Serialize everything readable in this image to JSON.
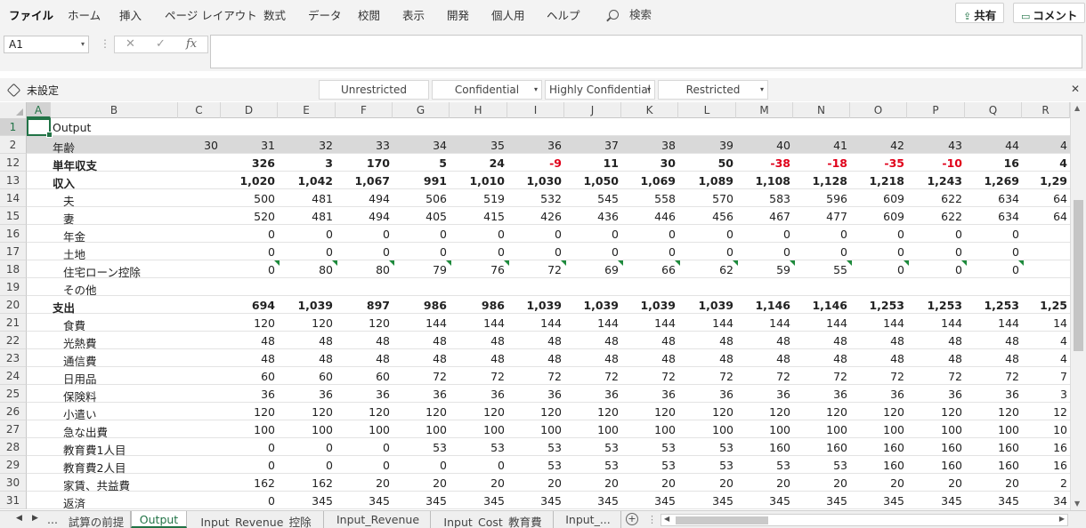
{
  "ribbon": {
    "tabs": [
      "ファイル",
      "ホーム",
      "挿入",
      "ページ レイアウト",
      "数式",
      "データ",
      "校閲",
      "表示",
      "開発",
      "個人用",
      "ヘルプ"
    ],
    "search_label": "検索",
    "share_label": "共有",
    "comment_label": "コメント"
  },
  "formula_bar": {
    "name_box": "A1",
    "formula": ""
  },
  "sensitivity": {
    "label": "未設定",
    "options": [
      "Unrestricted",
      "Confidential",
      "Highly Confidential",
      "Restricted"
    ]
  },
  "grid": {
    "columns": [
      "A",
      "B",
      "C",
      "D",
      "E",
      "F",
      "G",
      "H",
      "I",
      "J",
      "K",
      "L",
      "M",
      "N",
      "O",
      "P",
      "Q",
      "R"
    ],
    "rows": [
      {
        "n": "1",
        "label": "Output",
        "cells": []
      },
      {
        "n": "2",
        "label": "年齢",
        "cells": [
          "30",
          "31",
          "32",
          "33",
          "34",
          "35",
          "36",
          "37",
          "38",
          "39",
          "40",
          "41",
          "42",
          "43",
          "44",
          "4"
        ]
      },
      {
        "n": "12",
        "label": "単年収支",
        "cells": [
          "",
          "326",
          "3",
          "170",
          "5",
          "24",
          "-9",
          "11",
          "30",
          "50",
          "-38",
          "-18",
          "-35",
          "-10",
          "16",
          "4"
        ]
      },
      {
        "n": "13",
        "label": "収入",
        "cells": [
          "",
          "1,020",
          "1,042",
          "1,067",
          "991",
          "1,010",
          "1,030",
          "1,050",
          "1,069",
          "1,089",
          "1,108",
          "1,128",
          "1,218",
          "1,243",
          "1,269",
          "1,29"
        ]
      },
      {
        "n": "14",
        "label": "夫",
        "cells": [
          "",
          "500",
          "481",
          "494",
          "506",
          "519",
          "532",
          "545",
          "558",
          "570",
          "583",
          "596",
          "609",
          "622",
          "634",
          "64"
        ]
      },
      {
        "n": "15",
        "label": "妻",
        "cells": [
          "",
          "520",
          "481",
          "494",
          "405",
          "415",
          "426",
          "436",
          "446",
          "456",
          "467",
          "477",
          "609",
          "622",
          "634",
          "64"
        ]
      },
      {
        "n": "16",
        "label": "年金",
        "cells": [
          "",
          "0",
          "0",
          "0",
          "0",
          "0",
          "0",
          "0",
          "0",
          "0",
          "0",
          "0",
          "0",
          "0",
          "0",
          ""
        ]
      },
      {
        "n": "17",
        "label": "土地",
        "cells": [
          "",
          "0",
          "0",
          "0",
          "0",
          "0",
          "0",
          "0",
          "0",
          "0",
          "0",
          "0",
          "0",
          "0",
          "0",
          ""
        ]
      },
      {
        "n": "18",
        "label": "住宅ローン控除",
        "cells": [
          "",
          "0",
          "80",
          "80",
          "79",
          "76",
          "72",
          "69",
          "66",
          "62",
          "59",
          "55",
          "0",
          "0",
          "0",
          ""
        ]
      },
      {
        "n": "19",
        "label": "その他",
        "cells": []
      },
      {
        "n": "20",
        "label": "支出",
        "cells": [
          "",
          "694",
          "1,039",
          "897",
          "986",
          "986",
          "1,039",
          "1,039",
          "1,039",
          "1,039",
          "1,146",
          "1,146",
          "1,253",
          "1,253",
          "1,253",
          "1,25"
        ]
      },
      {
        "n": "21",
        "label": "食費",
        "cells": [
          "",
          "120",
          "120",
          "120",
          "144",
          "144",
          "144",
          "144",
          "144",
          "144",
          "144",
          "144",
          "144",
          "144",
          "144",
          "14"
        ]
      },
      {
        "n": "22",
        "label": "光熱費",
        "cells": [
          "",
          "48",
          "48",
          "48",
          "48",
          "48",
          "48",
          "48",
          "48",
          "48",
          "48",
          "48",
          "48",
          "48",
          "48",
          "4"
        ]
      },
      {
        "n": "23",
        "label": "通信費",
        "cells": [
          "",
          "48",
          "48",
          "48",
          "48",
          "48",
          "48",
          "48",
          "48",
          "48",
          "48",
          "48",
          "48",
          "48",
          "48",
          "4"
        ]
      },
      {
        "n": "24",
        "label": "日用品",
        "cells": [
          "",
          "60",
          "60",
          "60",
          "72",
          "72",
          "72",
          "72",
          "72",
          "72",
          "72",
          "72",
          "72",
          "72",
          "72",
          "7"
        ]
      },
      {
        "n": "25",
        "label": "保険料",
        "cells": [
          "",
          "36",
          "36",
          "36",
          "36",
          "36",
          "36",
          "36",
          "36",
          "36",
          "36",
          "36",
          "36",
          "36",
          "36",
          "3"
        ]
      },
      {
        "n": "26",
        "label": "小遣い",
        "cells": [
          "",
          "120",
          "120",
          "120",
          "120",
          "120",
          "120",
          "120",
          "120",
          "120",
          "120",
          "120",
          "120",
          "120",
          "120",
          "12"
        ]
      },
      {
        "n": "27",
        "label": "急な出費",
        "cells": [
          "",
          "100",
          "100",
          "100",
          "100",
          "100",
          "100",
          "100",
          "100",
          "100",
          "100",
          "100",
          "100",
          "100",
          "100",
          "10"
        ]
      },
      {
        "n": "28",
        "label": "教育費1人目",
        "cells": [
          "",
          "0",
          "0",
          "0",
          "53",
          "53",
          "53",
          "53",
          "53",
          "53",
          "160",
          "160",
          "160",
          "160",
          "160",
          "16"
        ]
      },
      {
        "n": "29",
        "label": "教育費2人目",
        "cells": [
          "",
          "0",
          "0",
          "0",
          "0",
          "0",
          "53",
          "53",
          "53",
          "53",
          "53",
          "53",
          "160",
          "160",
          "160",
          "16"
        ]
      },
      {
        "n": "30",
        "label": "家賃、共益費",
        "cells": [
          "",
          "162",
          "162",
          "20",
          "20",
          "20",
          "20",
          "20",
          "20",
          "20",
          "20",
          "20",
          "20",
          "20",
          "20",
          "2"
        ]
      },
      {
        "n": "31",
        "label": "返済",
        "cells": [
          "",
          "0",
          "345",
          "345",
          "345",
          "345",
          "345",
          "345",
          "345",
          "345",
          "345",
          "345",
          "345",
          "345",
          "345",
          "34"
        ]
      }
    ]
  },
  "sheets": {
    "more_left": "...",
    "tabs": [
      "試算の前提",
      "Output",
      "Input_Revenue_控除",
      "Input_Revenue",
      "Input_Cost_教育費",
      "Input_..."
    ],
    "active": "Output"
  },
  "colors": {
    "accent": "#217346",
    "negative": "#e0001a",
    "comment_marker": "#1e8a3c"
  }
}
